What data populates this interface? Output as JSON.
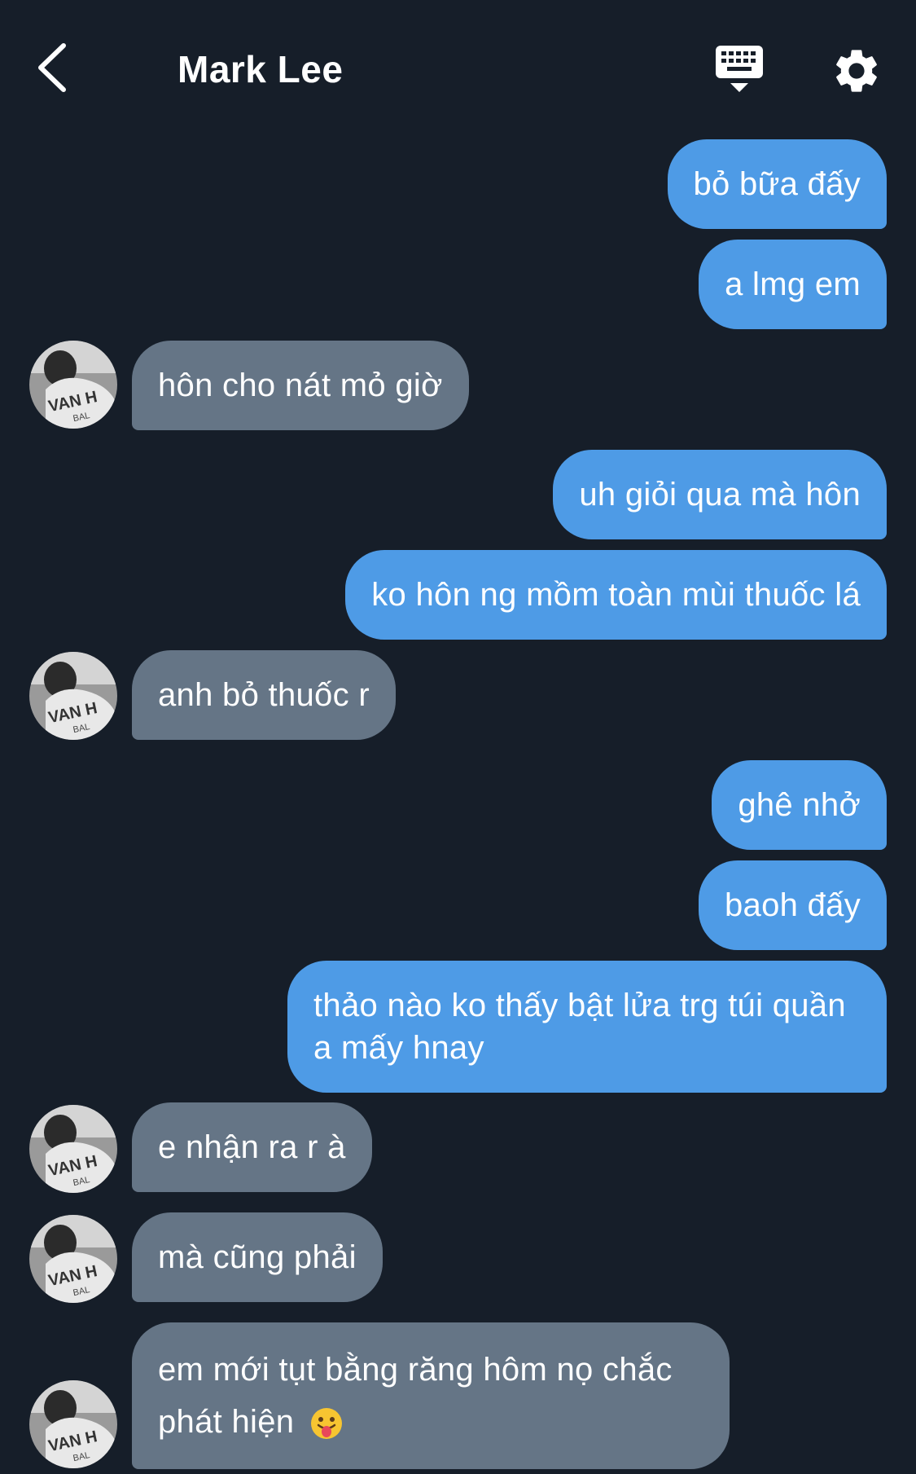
{
  "header": {
    "title": "Mark Lee",
    "back_icon": "chevron-left-icon",
    "keyboard_icon": "keyboard-icon",
    "settings_icon": "gear-icon"
  },
  "colors": {
    "background": "#161e29",
    "sent_bubble": "#4e9be6",
    "received_bubble": "#657586",
    "text": "#ffffff"
  },
  "messages": [
    {
      "from": "me",
      "text": "bỏ bữa đấy"
    },
    {
      "from": "me",
      "text": "a lmg em"
    },
    {
      "from": "them",
      "text": "hôn cho nát mỏ giờ"
    },
    {
      "from": "me",
      "text": "uh giỏi qua mà hôn"
    },
    {
      "from": "me",
      "text": "ko hôn ng mồm toàn mùi thuốc lá"
    },
    {
      "from": "them",
      "text": "anh bỏ thuốc r"
    },
    {
      "from": "me",
      "text": "ghê nhở"
    },
    {
      "from": "me",
      "text": "baoh đấy"
    },
    {
      "from": "me",
      "text": "thảo nào ko thấy bật lửa trg túi quần a mấy hnay"
    },
    {
      "from": "them",
      "text": "e nhận ra r à"
    },
    {
      "from": "them",
      "text": "mà cũng phải"
    },
    {
      "from": "them",
      "text": "em mới tụt bằng răng hôm nọ chắc phát hiện",
      "emoji": "tongue-out-emoji-icon"
    }
  ]
}
